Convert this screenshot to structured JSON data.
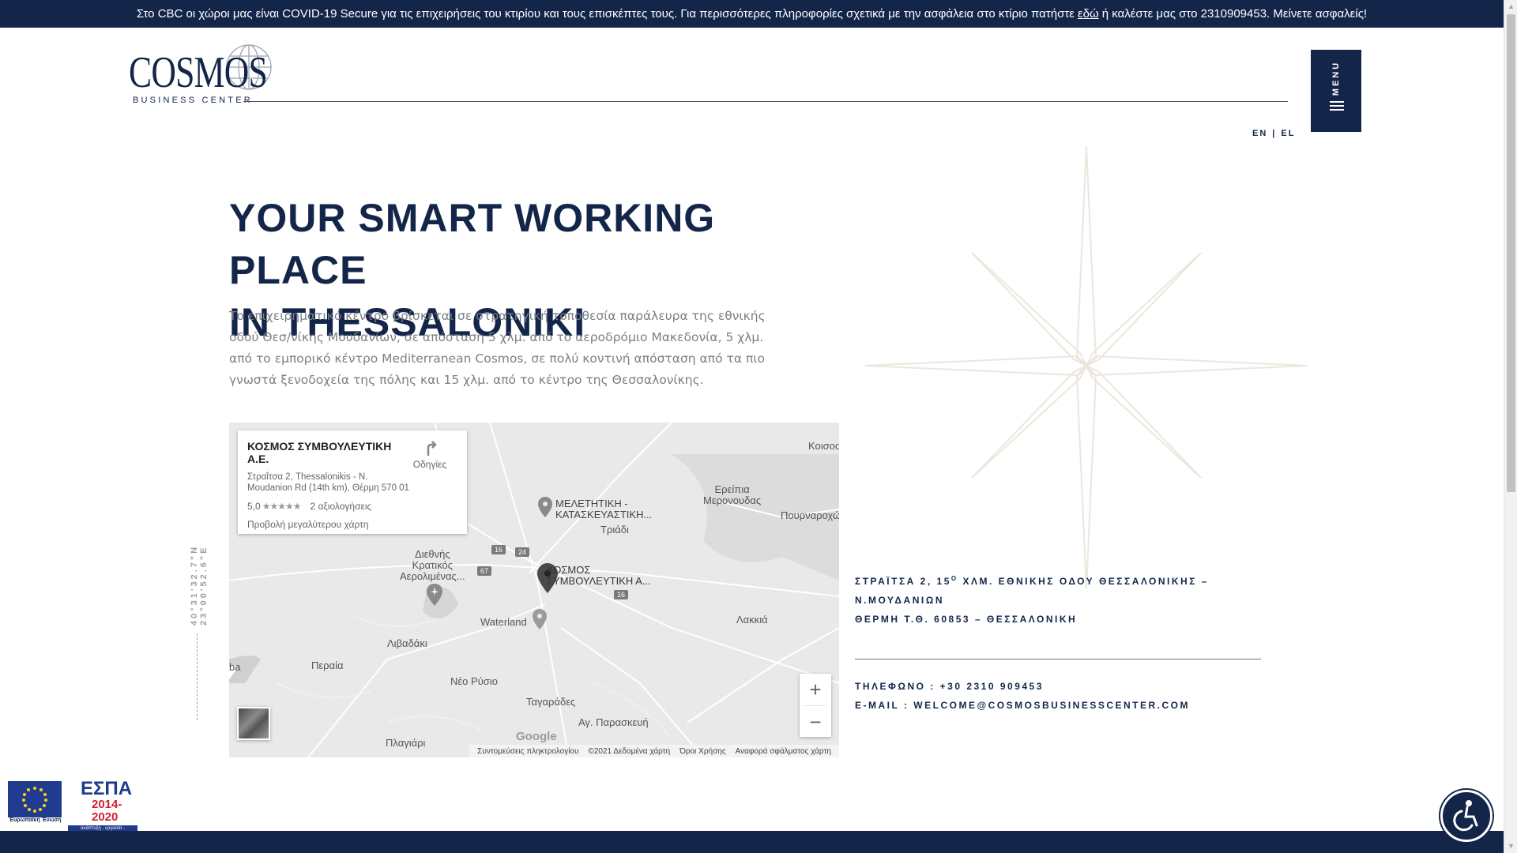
{
  "banner": {
    "text_before": "Στο CBC οι χώροι μας είναι COVID-19 Secure για τις επιχειρήσεις του κτιρίου και τους επισκέπτες τους. Για περισσότερες πληροφορίες σχετικά με την ασφάλεια στο κτίριο πατήστε",
    "link": "εδώ",
    "text_after": "ή καλέστε μας στο 2310909453. Μείνετε ασφαλείς!"
  },
  "logo": {
    "word": "COSMOS",
    "subtitle": "BUSINESS CENTER"
  },
  "menu": {
    "label": "MENU"
  },
  "lang": {
    "en": "EN",
    "sep": "|",
    "el": "EL"
  },
  "hero": {
    "title_line1": "YOUR SMART WORKING PLACE",
    "title_line2": "IN THESSALONIKI",
    "description": "Το επιχειρηματικό κέντρο βρίσκεται σε στρατηγική τοποθεσία παράλευρα της εθνικής οδού Θεσ/νίκης Μουδανίων, σε απόσταση 5 χλμ. από το αεροδρόμιο Μακεδονία, 5 χλμ. από το εμπορικό κέντρο Mediterranean Cosmos, σε πολύ κοντινή απόσταση από τα πιο γνωστά ξενοδοχεία της πόλης και 15 χλμ. από το κέντρο της Θεσσαλονίκης."
  },
  "coords": "40°31'32.7\"N 23°00'52.6\"E",
  "map": {
    "place_name": "ΚΟΣΜΟΣ ΣΥΜΒΟΥΛΕΥΤΙΚΗ Α.Ε.",
    "place_address": "Στραΐτσα 2, Thessalonikis - N. Moudanion Rd (14th km), Θέρμη 570 01",
    "rating": "5,0",
    "stars": "★★★★★",
    "reviews": "2 αξιολογήσεις",
    "bigger_map": "Προβολή μεγαλύτερου χάρτη",
    "directions": "Οδηγίες",
    "zoom_in": "+",
    "zoom_out": "−",
    "google": "Google",
    "labels": {
      "kosmos_marker": "ΚΟΣΜΟΣ\nΣΥΜΒΟΥΛΕΥΤΙΚΗ Α...",
      "meletitiki": "ΜΕΛΕΤΗΤΙΚΗ -\nΚΑΤΑΣΚΕΥΑΣΤΙΚΗ...",
      "triadi": "Τριάδι",
      "airport": "Διεθνής\nΚρατικός\nΑερολιμένας...",
      "waterland": "Waterland",
      "livadaki": "Λιβαδάκι",
      "peraia": "Περαία",
      "neo_rysio": "Νέο Ρύσιο",
      "tagarades": "Ταγαράδες",
      "ag_paraskevi": "Αγ. Παρασκευή",
      "plagiari": "Πλαγιάρι",
      "lakkia": "Λακκιά",
      "eremia": "Ερείπια\nΜερονουδας",
      "pournaroxori": "Πουρναροχώ...",
      "kosmos_top": "Κοισοσ",
      "ba": "ba"
    },
    "roads": [
      "16",
      "24",
      "67",
      "16"
    ],
    "attribution": {
      "shortcuts": "Συντομεύσεις πληκτρολογίου",
      "data": "©2021 Δεδομένα χάρτη",
      "terms": "Όροι Χρήσης",
      "report": "Αναφορά σφάλματος χάρτη"
    }
  },
  "address": {
    "line1": "ΣΤΡΑΪΤΣΑ 2, 15",
    "line1_sup": "Ο",
    "line1_rest": " ΧΛΜ. ΕΘΝΙΚΗΣ ΟΔΟΥ ΘΕΣΣΑΛΟΝΙΚΗΣ –",
    "line2": "Ν.ΜΟΥΔΑΝΙΩΝ",
    "line3": "ΘΕΡΜΗ Τ.Θ. 60853 – ΘΕΣΣΑΛΟΝΙΚΗ"
  },
  "contact": {
    "phone_label": "ΤΗΛΕΦΩΝΟ : ",
    "phone": "+30 2310 909453",
    "email_label": "E-MAIL : ",
    "email": "WELCOME@COSMOSBUSINESSCENTER.COM"
  },
  "espa": {
    "eu_caption": "Ευρωπαϊκή Ένωση",
    "title": "ΕΣΠΑ",
    "years": "2014-2020",
    "tagline": "ανάπτυξη - εργασία - αλληλεγγύη"
  },
  "colors": {
    "navy": "#13264a",
    "gray_text": "#7a7f87",
    "map_bg": "#e8e8e8"
  },
  "icons": {
    "menu": "hamburger-icon",
    "accessibility": "accessibility-icon",
    "directions": "directions-icon",
    "marker": "map-pin-icon"
  }
}
